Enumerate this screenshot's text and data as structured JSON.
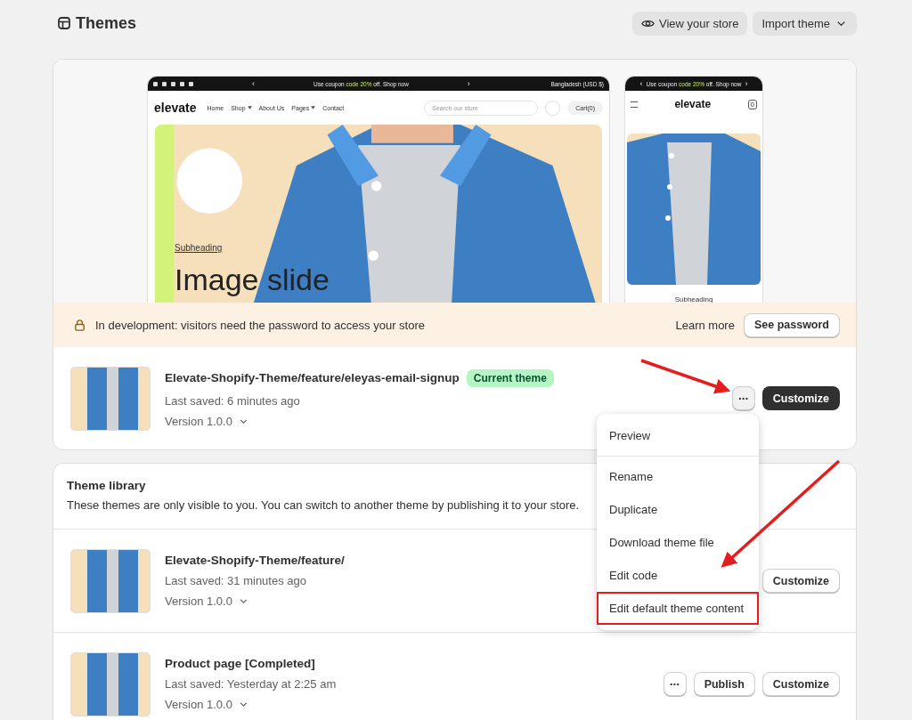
{
  "page": {
    "title": "Themes",
    "buttons": [
      {
        "label": "View your store",
        "kind": "eye"
      },
      {
        "label": "Import theme",
        "kind": "dropdown"
      }
    ]
  },
  "preview": {
    "desktop": {
      "announcement": {
        "prev": "‹",
        "before": "Use coupon ",
        "code": "code 20%",
        "after": " off. Shop now",
        "next": "›"
      },
      "region": "Bangladesh (USD $)",
      "logo": "elevate",
      "nav": [
        {
          "label": "Home",
          "has_menu": false
        },
        {
          "label": "Shop",
          "has_menu": true
        },
        {
          "label": "About Us",
          "has_menu": false
        },
        {
          "label": "Pages",
          "has_menu": true
        },
        {
          "label": "Contact",
          "has_menu": false
        }
      ],
      "search_placeholder": "Search our store",
      "cart": "Cart(0)",
      "subheading": "Subheading",
      "heading": "Image slide"
    },
    "mobile": {
      "announcement": {
        "prev": "‹",
        "before": "Use coupon ",
        "code": "code 20%",
        "after": " off. Shop now",
        "next": "›"
      },
      "logo": "elevate",
      "cart_count": "0",
      "subheading": "Subheading"
    }
  },
  "banner": {
    "text": "In development: visitors need the password to access your store",
    "link": "Learn more",
    "button": "See password"
  },
  "current_theme": {
    "name": "Elevate-Shopify-Theme/feature/eleyas-email-signup",
    "badge": "Current theme",
    "last_saved": "Last saved: 6 minutes ago",
    "version": "Version 1.0.0",
    "customize": "Customize",
    "more": "•••"
  },
  "menu": {
    "groups": [
      {
        "items": [
          {
            "label": "Preview",
            "highlighted": false
          }
        ]
      },
      {
        "items": [
          {
            "label": "Rename",
            "highlighted": false
          },
          {
            "label": "Duplicate",
            "highlighted": false
          },
          {
            "label": "Download theme file",
            "highlighted": false
          },
          {
            "label": "Edit code",
            "highlighted": false
          },
          {
            "label": "Edit default theme content",
            "highlighted": true
          }
        ]
      }
    ]
  },
  "library": {
    "title": "Theme library",
    "description": "These themes are only visible to you. You can switch to another theme by publishing it to your store.",
    "themes": [
      {
        "name": "Elevate-Shopify-Theme/feature/",
        "last_saved": "Last saved: 31 minutes ago",
        "version": "Version 1.0.0",
        "customize": "Customize"
      },
      {
        "name": "Product page [Completed]",
        "last_saved": "Last saved: Yesterday at 2:25 am",
        "version": "Version 1.0.0",
        "more": "•••",
        "publish": "Publish",
        "customize": "Customize"
      }
    ]
  }
}
